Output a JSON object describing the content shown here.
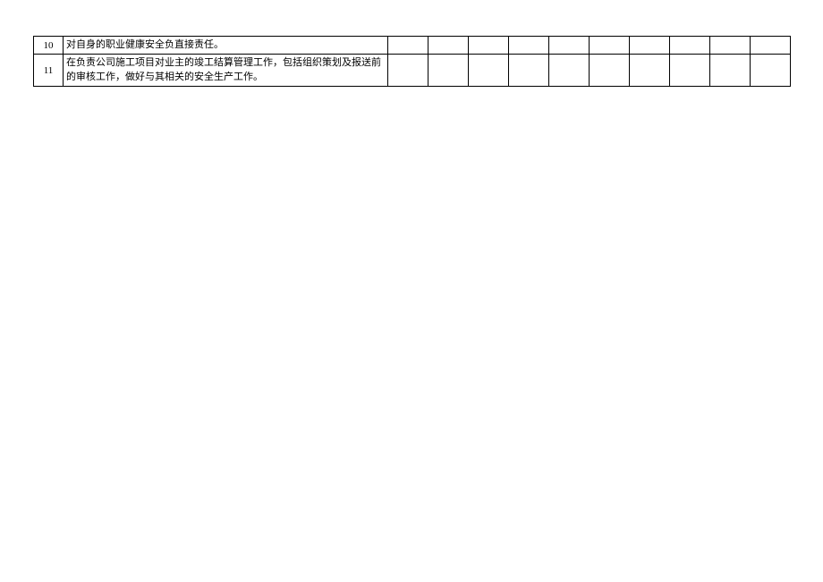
{
  "rows": [
    {
      "num": "10",
      "desc": "对自身的职业健康安全负直接责任。"
    },
    {
      "num": "11",
      "desc": "在负责公司施工项目对业主的竣工结算管理工作，包括组织策划及报送前的审核工作，做好与其相关的安全生产工作。"
    }
  ]
}
